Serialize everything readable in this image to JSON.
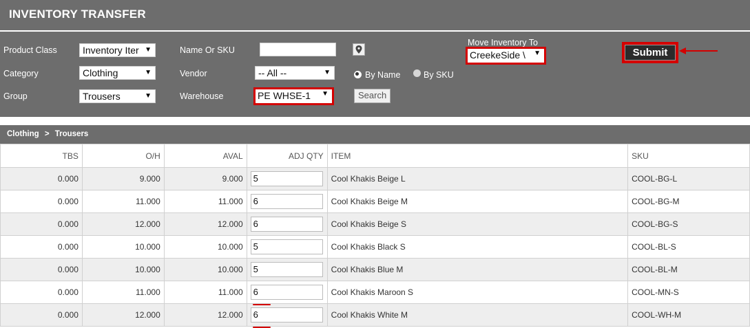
{
  "header": {
    "title": "INVENTORY TRANSFER"
  },
  "filters": {
    "product_class": {
      "label": "Product Class",
      "value": "Inventory Iter"
    },
    "category": {
      "label": "Category",
      "value": "Clothing"
    },
    "group": {
      "label": "Group",
      "value": "Trousers"
    },
    "name_or_sku": {
      "label": "Name Or SKU",
      "value": ""
    },
    "vendor": {
      "label": "Vendor",
      "value": "-- All --"
    },
    "warehouse": {
      "label": "Warehouse",
      "value": "PE WHSE-1"
    },
    "radio_by_name": {
      "label": "By Name",
      "selected": true
    },
    "radio_by_sku": {
      "label": "By SKU",
      "selected": false
    },
    "search_button": "Search",
    "move_to": {
      "label": "Move Inventory To",
      "value": "CreekeSide \\"
    },
    "submit_button": "Submit"
  },
  "breadcrumb": {
    "category": "Clothing",
    "separator": ">",
    "group": "Trousers"
  },
  "table": {
    "columns": [
      "TBS",
      "O/H",
      "AVAL",
      "ADJ QTY",
      "ITEM",
      "SKU"
    ],
    "rows": [
      {
        "tbs": "0.000",
        "oh": "9.000",
        "aval": "9.000",
        "adj": "5",
        "item": "Cool Khakis Beige L",
        "sku": "COOL-BG-L"
      },
      {
        "tbs": "0.000",
        "oh": "11.000",
        "aval": "11.000",
        "adj": "6",
        "item": "Cool Khakis Beige M",
        "sku": "COOL-BG-M"
      },
      {
        "tbs": "0.000",
        "oh": "12.000",
        "aval": "12.000",
        "adj": "6",
        "item": "Cool Khakis Beige S",
        "sku": "COOL-BG-S"
      },
      {
        "tbs": "0.000",
        "oh": "10.000",
        "aval": "10.000",
        "adj": "5",
        "item": "Cool Khakis Black S",
        "sku": "COOL-BL-S"
      },
      {
        "tbs": "0.000",
        "oh": "10.000",
        "aval": "10.000",
        "adj": "5",
        "item": "Cool Khakis Blue M",
        "sku": "COOL-BL-M"
      },
      {
        "tbs": "0.000",
        "oh": "11.000",
        "aval": "11.000",
        "adj": "6",
        "item": "Cool Khakis Maroon S",
        "sku": "COOL-MN-S"
      },
      {
        "tbs": "0.000",
        "oh": "12.000",
        "aval": "12.000",
        "adj": "6",
        "item": "Cool Khakis White M",
        "sku": "COOL-WH-M"
      }
    ]
  },
  "colors": {
    "panel": "#6d6d6d",
    "highlight": "#d40000",
    "row_alt": "#eeeeee"
  },
  "icons": {
    "location": "map-pin-icon",
    "annotation": "red-arrow-icon"
  }
}
